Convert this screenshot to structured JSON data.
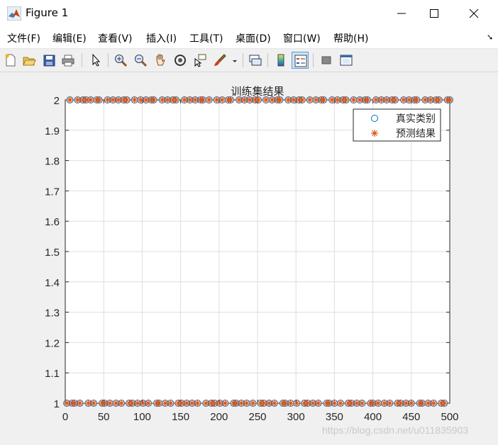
{
  "window": {
    "title": "Figure 1",
    "icon": "matlab-logo-icon",
    "controls": [
      "minimize-icon",
      "maximize-icon",
      "close-icon"
    ]
  },
  "menu": {
    "items": [
      "文件(F)",
      "编辑(E)",
      "查看(V)",
      "插入(I)",
      "工具(T)",
      "桌面(D)",
      "窗口(W)",
      "帮助(H)"
    ]
  },
  "toolbar": {
    "icons": [
      "new-figure-icon",
      "open-file-icon",
      "save-icon",
      "print-icon",
      "pointer-icon",
      "zoom-in-icon",
      "zoom-out-icon",
      "pan-icon",
      "rotate-3d-icon",
      "data-cursor-icon",
      "brush-icon",
      "brush-dropdown-icon",
      "link-plot-icon",
      "colorbar-icon",
      "legend-icon",
      "hide-plot-tools-icon",
      "show-plot-tools-icon"
    ],
    "pressed": "legend-icon"
  },
  "watermark": "https://blog.csdn.net/u011835903",
  "chart_data": {
    "type": "scatter",
    "title": "训练集结果",
    "xlabel": "",
    "ylabel": "",
    "xlim": [
      0,
      500
    ],
    "ylim": [
      1,
      2
    ],
    "xticks": [
      0,
      50,
      100,
      150,
      200,
      250,
      300,
      350,
      400,
      450,
      500
    ],
    "yticks": [
      1,
      1.1,
      1.2,
      1.3,
      1.4,
      1.5,
      1.6,
      1.7,
      1.8,
      1.9,
      2
    ],
    "grid": true,
    "legend_position": "top-right",
    "series": [
      {
        "name": "真实类别",
        "marker": "circle",
        "color": "#0072BD",
        "points": [
          [
            2,
            1
          ],
          [
            6,
            2
          ],
          [
            9,
            1
          ],
          [
            12,
            1
          ],
          [
            16,
            2
          ],
          [
            19,
            1
          ],
          [
            23,
            2
          ],
          [
            27,
            2
          ],
          [
            30,
            1
          ],
          [
            33,
            2
          ],
          [
            37,
            1
          ],
          [
            41,
            2
          ],
          [
            44,
            2
          ],
          [
            48,
            1
          ],
          [
            51,
            1
          ],
          [
            55,
            2
          ],
          [
            58,
            1
          ],
          [
            62,
            2
          ],
          [
            66,
            1
          ],
          [
            69,
            2
          ],
          [
            73,
            1
          ],
          [
            76,
            2
          ],
          [
            80,
            2
          ],
          [
            83,
            1
          ],
          [
            87,
            1
          ],
          [
            90,
            2
          ],
          [
            94,
            1
          ],
          [
            98,
            2
          ],
          [
            101,
            1
          ],
          [
            105,
            2
          ],
          [
            108,
            1
          ],
          [
            112,
            2
          ],
          [
            115,
            2
          ],
          [
            119,
            1
          ],
          [
            122,
            1
          ],
          [
            126,
            2
          ],
          [
            130,
            1
          ],
          [
            133,
            2
          ],
          [
            137,
            1
          ],
          [
            140,
            2
          ],
          [
            144,
            2
          ],
          [
            147,
            1
          ],
          [
            151,
            1
          ],
          [
            155,
            2
          ],
          [
            158,
            1
          ],
          [
            162,
            2
          ],
          [
            165,
            1
          ],
          [
            169,
            2
          ],
          [
            172,
            1
          ],
          [
            176,
            2
          ],
          [
            179,
            2
          ],
          [
            183,
            1
          ],
          [
            187,
            2
          ],
          [
            190,
            1
          ],
          [
            194,
            1
          ],
          [
            197,
            2
          ],
          [
            201,
            1
          ],
          [
            204,
            2
          ],
          [
            208,
            1
          ],
          [
            212,
            2
          ],
          [
            215,
            2
          ],
          [
            219,
            1
          ],
          [
            222,
            1
          ],
          [
            226,
            2
          ],
          [
            229,
            1
          ],
          [
            233,
            2
          ],
          [
            236,
            1
          ],
          [
            240,
            2
          ],
          [
            244,
            1
          ],
          [
            247,
            2
          ],
          [
            251,
            2
          ],
          [
            254,
            1
          ],
          [
            258,
            1
          ],
          [
            261,
            2
          ],
          [
            265,
            1
          ],
          [
            269,
            2
          ],
          [
            272,
            1
          ],
          [
            276,
            2
          ],
          [
            279,
            2
          ],
          [
            283,
            1
          ],
          [
            286,
            1
          ],
          [
            290,
            2
          ],
          [
            293,
            1
          ],
          [
            297,
            2
          ],
          [
            301,
            1
          ],
          [
            304,
            2
          ],
          [
            308,
            2
          ],
          [
            311,
            1
          ],
          [
            315,
            1
          ],
          [
            318,
            2
          ],
          [
            322,
            1
          ],
          [
            326,
            2
          ],
          [
            329,
            1
          ],
          [
            333,
            2
          ],
          [
            336,
            2
          ],
          [
            340,
            1
          ],
          [
            343,
            1
          ],
          [
            347,
            2
          ],
          [
            350,
            1
          ],
          [
            354,
            2
          ],
          [
            358,
            1
          ],
          [
            361,
            2
          ],
          [
            365,
            2
          ],
          [
            368,
            1
          ],
          [
            372,
            1
          ],
          [
            375,
            2
          ],
          [
            379,
            1
          ],
          [
            383,
            2
          ],
          [
            386,
            1
          ],
          [
            390,
            2
          ],
          [
            393,
            2
          ],
          [
            397,
            1
          ],
          [
            400,
            1
          ],
          [
            404,
            2
          ],
          [
            407,
            1
          ],
          [
            411,
            2
          ],
          [
            415,
            1
          ],
          [
            418,
            2
          ],
          [
            422,
            1
          ],
          [
            425,
            2
          ],
          [
            429,
            2
          ],
          [
            432,
            1
          ],
          [
            436,
            1
          ],
          [
            440,
            2
          ],
          [
            443,
            1
          ],
          [
            447,
            2
          ],
          [
            450,
            1
          ],
          [
            454,
            2
          ],
          [
            457,
            2
          ],
          [
            461,
            1
          ],
          [
            464,
            1
          ],
          [
            468,
            2
          ],
          [
            472,
            1
          ],
          [
            475,
            2
          ],
          [
            479,
            1
          ],
          [
            482,
            2
          ],
          [
            486,
            2
          ],
          [
            489,
            1
          ],
          [
            493,
            1
          ],
          [
            497,
            2
          ],
          [
            500,
            2
          ]
        ]
      },
      {
        "name": "预测结果",
        "marker": "asterisk",
        "color": "#D95319",
        "points": [
          [
            2,
            1
          ],
          [
            6,
            2
          ],
          [
            9,
            1
          ],
          [
            12,
            1
          ],
          [
            16,
            2
          ],
          [
            19,
            1
          ],
          [
            23,
            2
          ],
          [
            27,
            2
          ],
          [
            30,
            1
          ],
          [
            33,
            2
          ],
          [
            37,
            1
          ],
          [
            41,
            2
          ],
          [
            44,
            2
          ],
          [
            48,
            1
          ],
          [
            51,
            1
          ],
          [
            55,
            2
          ],
          [
            58,
            1
          ],
          [
            62,
            2
          ],
          [
            66,
            1
          ],
          [
            69,
            2
          ],
          [
            73,
            1
          ],
          [
            76,
            2
          ],
          [
            80,
            2
          ],
          [
            83,
            1
          ],
          [
            87,
            1
          ],
          [
            90,
            2
          ],
          [
            94,
            1
          ],
          [
            98,
            2
          ],
          [
            101,
            1
          ],
          [
            105,
            2
          ],
          [
            108,
            1
          ],
          [
            112,
            2
          ],
          [
            115,
            2
          ],
          [
            119,
            1
          ],
          [
            122,
            1
          ],
          [
            126,
            2
          ],
          [
            130,
            1
          ],
          [
            133,
            2
          ],
          [
            137,
            1
          ],
          [
            140,
            2
          ],
          [
            144,
            2
          ],
          [
            147,
            1
          ],
          [
            151,
            1
          ],
          [
            155,
            2
          ],
          [
            158,
            1
          ],
          [
            162,
            2
          ],
          [
            165,
            1
          ],
          [
            169,
            2
          ],
          [
            172,
            1
          ],
          [
            176,
            2
          ],
          [
            179,
            2
          ],
          [
            183,
            1
          ],
          [
            187,
            2
          ],
          [
            190,
            1
          ],
          [
            194,
            1
          ],
          [
            197,
            2
          ],
          [
            201,
            1
          ],
          [
            204,
            2
          ],
          [
            208,
            1
          ],
          [
            212,
            2
          ],
          [
            215,
            2
          ],
          [
            219,
            1
          ],
          [
            222,
            1
          ],
          [
            226,
            2
          ],
          [
            229,
            1
          ],
          [
            233,
            2
          ],
          [
            236,
            1
          ],
          [
            240,
            2
          ],
          [
            244,
            1
          ],
          [
            247,
            2
          ],
          [
            251,
            2
          ],
          [
            254,
            1
          ],
          [
            258,
            1
          ],
          [
            261,
            2
          ],
          [
            265,
            1
          ],
          [
            269,
            2
          ],
          [
            272,
            1
          ],
          [
            276,
            2
          ],
          [
            279,
            2
          ],
          [
            283,
            1
          ],
          [
            286,
            1
          ],
          [
            290,
            2
          ],
          [
            293,
            1
          ],
          [
            297,
            2
          ],
          [
            301,
            1
          ],
          [
            304,
            2
          ],
          [
            308,
            2
          ],
          [
            311,
            1
          ],
          [
            315,
            1
          ],
          [
            318,
            2
          ],
          [
            322,
            1
          ],
          [
            326,
            2
          ],
          [
            329,
            1
          ],
          [
            333,
            2
          ],
          [
            336,
            2
          ],
          [
            340,
            1
          ],
          [
            343,
            1
          ],
          [
            347,
            2
          ],
          [
            350,
            1
          ],
          [
            354,
            2
          ],
          [
            358,
            1
          ],
          [
            361,
            2
          ],
          [
            365,
            2
          ],
          [
            368,
            1
          ],
          [
            372,
            1
          ],
          [
            375,
            2
          ],
          [
            379,
            1
          ],
          [
            383,
            2
          ],
          [
            386,
            1
          ],
          [
            390,
            2
          ],
          [
            393,
            2
          ],
          [
            397,
            1
          ],
          [
            400,
            1
          ],
          [
            404,
            2
          ],
          [
            407,
            1
          ],
          [
            411,
            2
          ],
          [
            415,
            1
          ],
          [
            418,
            2
          ],
          [
            422,
            1
          ],
          [
            425,
            2
          ],
          [
            429,
            2
          ],
          [
            432,
            1
          ],
          [
            436,
            1
          ],
          [
            440,
            2
          ],
          [
            443,
            1
          ],
          [
            447,
            2
          ],
          [
            450,
            1
          ],
          [
            454,
            2
          ],
          [
            457,
            2
          ],
          [
            461,
            1
          ],
          [
            464,
            1
          ],
          [
            468,
            2
          ],
          [
            472,
            1
          ],
          [
            475,
            2
          ],
          [
            479,
            1
          ],
          [
            482,
            2
          ],
          [
            486,
            2
          ],
          [
            489,
            1
          ],
          [
            493,
            1
          ],
          [
            497,
            2
          ],
          [
            500,
            2
          ]
        ]
      }
    ]
  }
}
